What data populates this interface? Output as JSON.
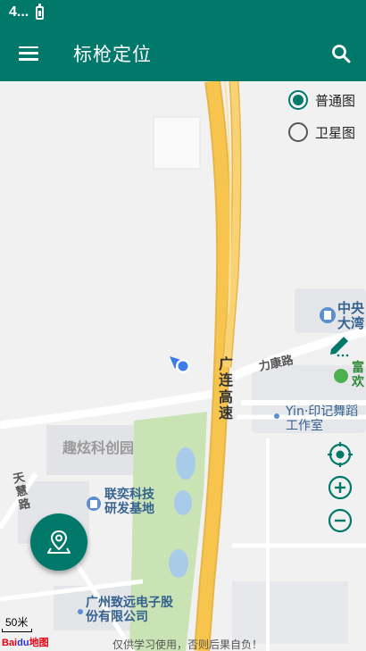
{
  "status": {
    "time": "4..."
  },
  "app_bar": {
    "title": "标枪定位"
  },
  "map_type": {
    "normal": "普通图",
    "satellite": "卫星图",
    "selected": "normal"
  },
  "map_labels": {
    "road_guanglian": "广连高速",
    "road_likang": "力康路",
    "quxuan": "趣炫科创园",
    "tianhui": "天慧路",
    "lianyi": "联奕科技研发基地",
    "yinji": "Yin·印记舞蹈工作室",
    "guangzhou_zhiyuan": "广州致远电子股份有限公司",
    "zhongyang": "中央大湾",
    "fu": "富欢"
  },
  "scale": {
    "label": "50米"
  },
  "attribution": {
    "logo": "Bai",
    "logo_du": "du",
    "logo_suffix": "地图"
  },
  "disclaimer": "仅供学习使用，否则后果自负！",
  "colors": {
    "primary": "#00796b",
    "highway": "#f7c54e",
    "road": "#ffffff",
    "park": "#c9e3b4",
    "water": "#a9cbea"
  },
  "icons": {
    "menu": "menu-icon",
    "search": "search-icon",
    "locate": "locate-icon",
    "zoom_in": "zoom-in-icon",
    "zoom_out": "zoom-out-icon",
    "pin": "location-pin-icon",
    "edit": "pencil-icon"
  }
}
